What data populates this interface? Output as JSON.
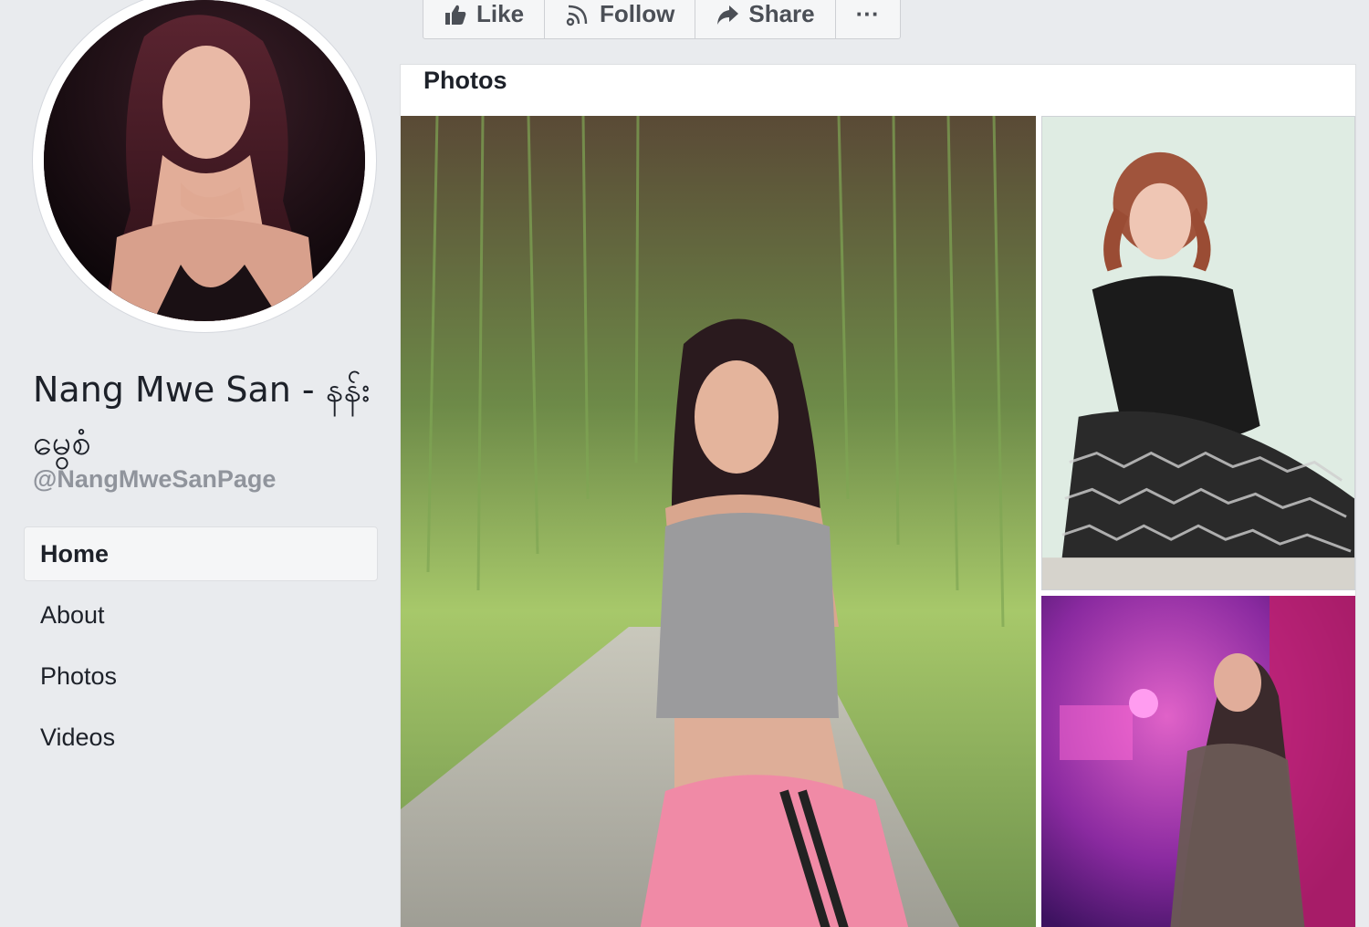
{
  "profile": {
    "name": "Nang Mwe San - နန်းမွေစံ",
    "handle": "@NangMweSanPage"
  },
  "nav": {
    "items": [
      {
        "label": "Home",
        "active": true
      },
      {
        "label": "About",
        "active": false
      },
      {
        "label": "Photos",
        "active": false
      },
      {
        "label": "Videos",
        "active": false
      }
    ]
  },
  "actions": {
    "like": "Like",
    "follow": "Follow",
    "share": "Share",
    "more": "···"
  },
  "photos": {
    "title": "Photos"
  },
  "colors": {
    "background": "#e9ebee",
    "text_primary": "#1d2129",
    "text_secondary": "#90949c",
    "button_text": "#4b4f56"
  }
}
